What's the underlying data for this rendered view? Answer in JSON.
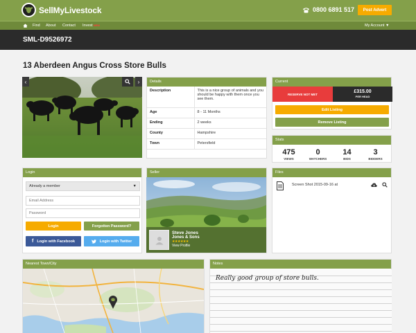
{
  "header": {
    "logo_text": "SellMyLivestock",
    "phone": "0800 6891 517",
    "post_advert": "Post Advert"
  },
  "nav": {
    "items": [
      "Find",
      "About",
      "Contact",
      "Invest"
    ],
    "invest_badge": "NEW",
    "account": "My Account"
  },
  "lot": {
    "ref": "SML-D9526972",
    "title": "13 Aberdeen Angus Cross Store Bulls"
  },
  "details": {
    "heading": "Details",
    "rows": [
      {
        "key": "Description",
        "value": "This is a nice group of animals and you should be happy with them once you see them."
      },
      {
        "key": "Age",
        "value": "8 - 11 Months"
      },
      {
        "key": "Ending",
        "value": "2 weeks"
      },
      {
        "key": "County",
        "value": "Hampshire"
      },
      {
        "key": "Town",
        "value": "Petersfield"
      }
    ]
  },
  "current": {
    "heading": "Current",
    "reserve": "RESERVE NOT MET",
    "price": "£315.00",
    "price_unit": "PER HEAD",
    "edit": "Edit Listing",
    "remove": "Remove Listing"
  },
  "stats": {
    "heading": "Stats",
    "items": [
      {
        "num": "475",
        "label": "VIEWS"
      },
      {
        "num": "0",
        "label": "WATCHERS"
      },
      {
        "num": "14",
        "label": "BIDS"
      },
      {
        "num": "3",
        "label": "BIDDERS"
      }
    ]
  },
  "login": {
    "heading": "Login",
    "select_value": "Already a member",
    "email_placeholder": "Email Address",
    "password_placeholder": "Password",
    "login_btn": "Login",
    "forgot_btn": "Forgotten Password?",
    "facebook_btn": "Login with Facebook",
    "twitter_btn": "Login with Twitter"
  },
  "seller": {
    "heading": "Seller",
    "name": "Steve Jones",
    "company": "Jones & Sons",
    "stars": "★★★★★★",
    "profile_link": "View Profile"
  },
  "files": {
    "heading": "Files",
    "items": [
      {
        "name": "Screen Shot 2015-09-16 at"
      }
    ]
  },
  "map": {
    "heading": "Nearest Town/City"
  },
  "notes": {
    "heading": "Notes",
    "text": "Really good group of store bulls."
  },
  "colors": {
    "brand_green": "#84a04a",
    "nav_green": "#6f8a3a",
    "accent_orange": "#f6ab00",
    "reserve_red": "#e83c3c",
    "facebook": "#3b5998",
    "twitter": "#55acee"
  }
}
